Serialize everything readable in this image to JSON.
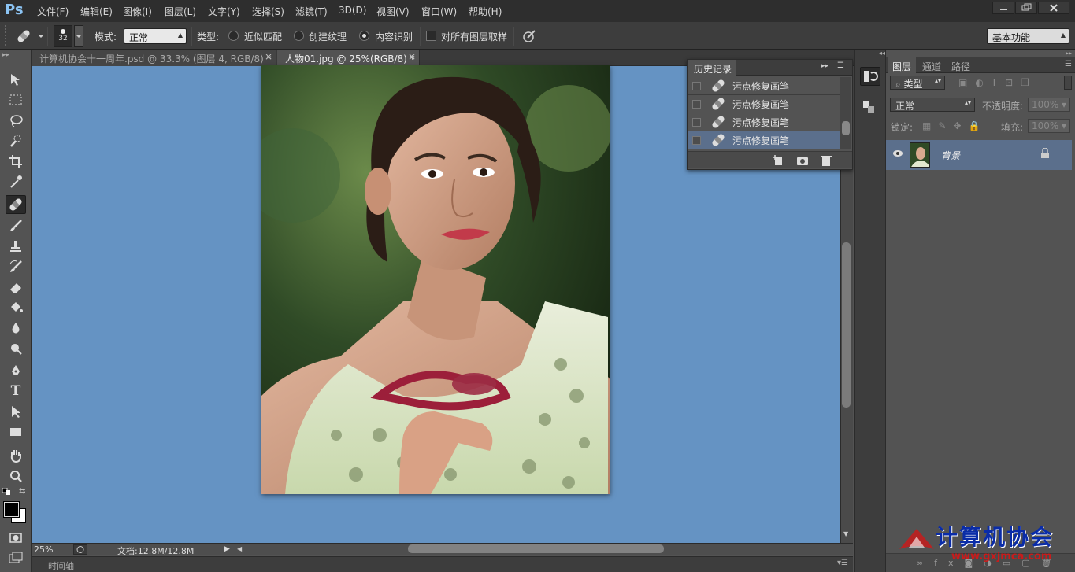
{
  "app": {
    "logo": "Ps"
  },
  "menu": [
    "文件(F)",
    "编辑(E)",
    "图像(I)",
    "图层(L)",
    "文字(Y)",
    "选择(S)",
    "滤镜(T)",
    "3D(D)",
    "视图(V)",
    "窗口(W)",
    "帮助(H)"
  ],
  "options": {
    "brush_size": "32",
    "mode_label": "模式:",
    "mode_value": "正常",
    "type_label": "类型:",
    "type_options": [
      "近似匹配",
      "创建纹理",
      "内容识别"
    ],
    "selected_type": "内容识别",
    "sample_all_label": "对所有图层取样",
    "workspace": "基本功能"
  },
  "tabs": [
    {
      "label": "计算机协会十一周年.psd @ 33.3% (图层 4, RGB/8) *",
      "active": false
    },
    {
      "label": "人物01.jpg @ 25%(RGB/8) *",
      "active": true
    }
  ],
  "history": {
    "title": "历史记录",
    "items": [
      "污点修复画笔",
      "污点修复画笔",
      "污点修复画笔",
      "污点修复画笔"
    ],
    "selected_index": 3
  },
  "layers": {
    "tabs": [
      "图层",
      "通道",
      "路径"
    ],
    "filter_label": "类型",
    "blend_mode": "正常",
    "opacity_label": "不透明度:",
    "opacity_value": "100%",
    "lock_label": "锁定:",
    "fill_label": "填充:",
    "fill_value": "100%",
    "items": [
      {
        "name": "背景",
        "visible": true,
        "locked": true
      }
    ]
  },
  "status": {
    "zoom": "25%",
    "doc_info": "文档:12.8M/12.8M",
    "timeline_label": "时间轴"
  },
  "watermark": {
    "text": "计算机协会",
    "url": "www.gxjmca.com"
  }
}
